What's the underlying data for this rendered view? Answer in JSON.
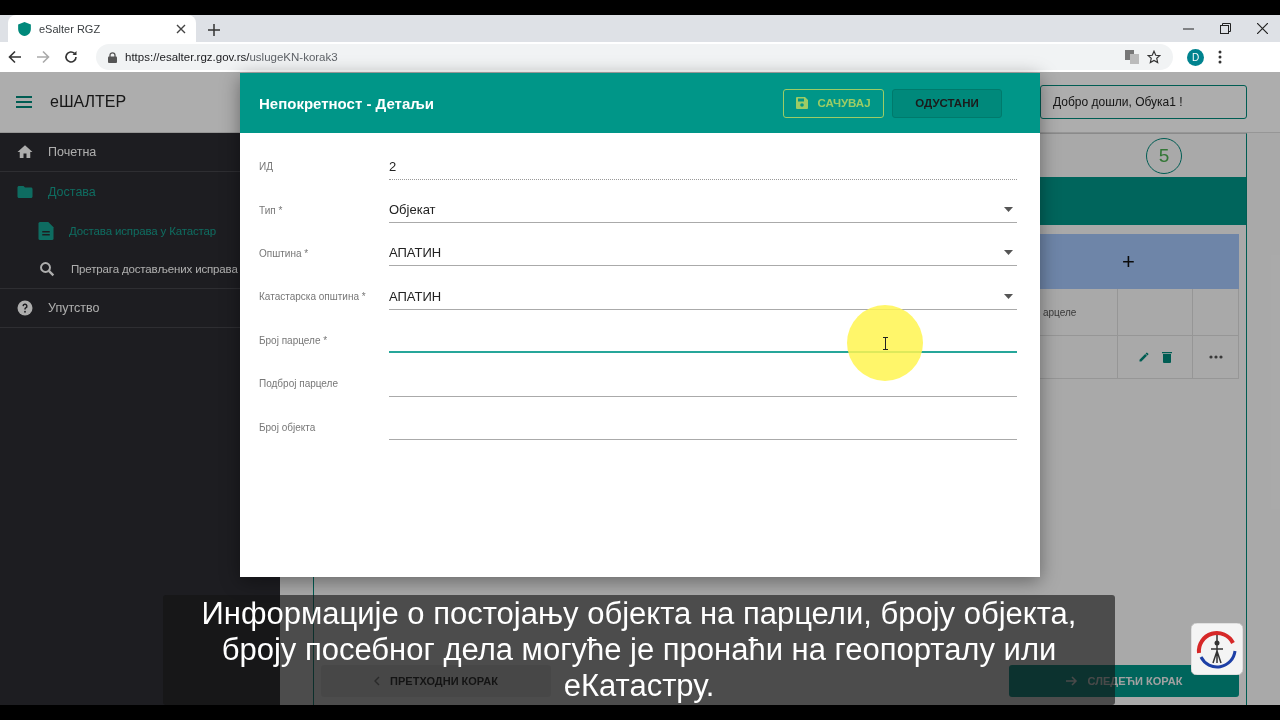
{
  "browser": {
    "tab_title": "eSalter RGZ",
    "url_host": "https://esalter.rgz.gov.rs/",
    "url_path": "uslugeKN-korak3",
    "profile_initial": "D"
  },
  "app": {
    "title": "еШАЛТЕР",
    "welcome": "Добро дошли, Обука1 !"
  },
  "sidebar": {
    "items": [
      {
        "label": "Почетна",
        "selected": false
      },
      {
        "label": "Достава",
        "selected": true,
        "expanded": true,
        "children": [
          {
            "label": "Достава исправа у Катастар",
            "selected": true
          },
          {
            "label": "Претрага достављених исправа",
            "selected": false
          }
        ]
      },
      {
        "label": "Упутство",
        "selected": false
      }
    ]
  },
  "stepper": {
    "current_step": "5"
  },
  "table": {
    "add_button": "+",
    "rows": [
      {
        "column_2": "арцеле"
      }
    ]
  },
  "footer": {
    "prev": "ПРЕТХОДНИ КОРАК",
    "next": "СЛЕДЕЋИ КОРАК"
  },
  "dialog": {
    "title": "Непокретност - Детаљи",
    "buttons": [
      {
        "label": "САЧУВАЈ",
        "kind": "save"
      },
      {
        "label": "ОДУСТАНИ",
        "kind": "cancel"
      }
    ],
    "fields": [
      {
        "label": "ИД",
        "value": "2",
        "kind": "readonly",
        "focused": false
      },
      {
        "label": "Тип *",
        "value": "Објекат",
        "kind": "select",
        "focused": false
      },
      {
        "label": "Општина *",
        "value": "АПАТИН",
        "kind": "select",
        "focused": false
      },
      {
        "label": "Катастарска општина *",
        "value": "АПАТИН",
        "kind": "select",
        "focused": false
      },
      {
        "label": "Број парцеле *",
        "kind": "text",
        "focused": true
      },
      {
        "label": "Подброј парцеле",
        "kind": "text",
        "focused": false
      },
      {
        "label": "Број објекта",
        "kind": "text",
        "focused": false
      }
    ]
  },
  "subtitle": {
    "lines": [
      "Информације о постојању објекта на парцели, броју објекта,",
      "броју посебног дела могуће је пронаћи на геопорталу или",
      "еКатастру."
    ]
  }
}
